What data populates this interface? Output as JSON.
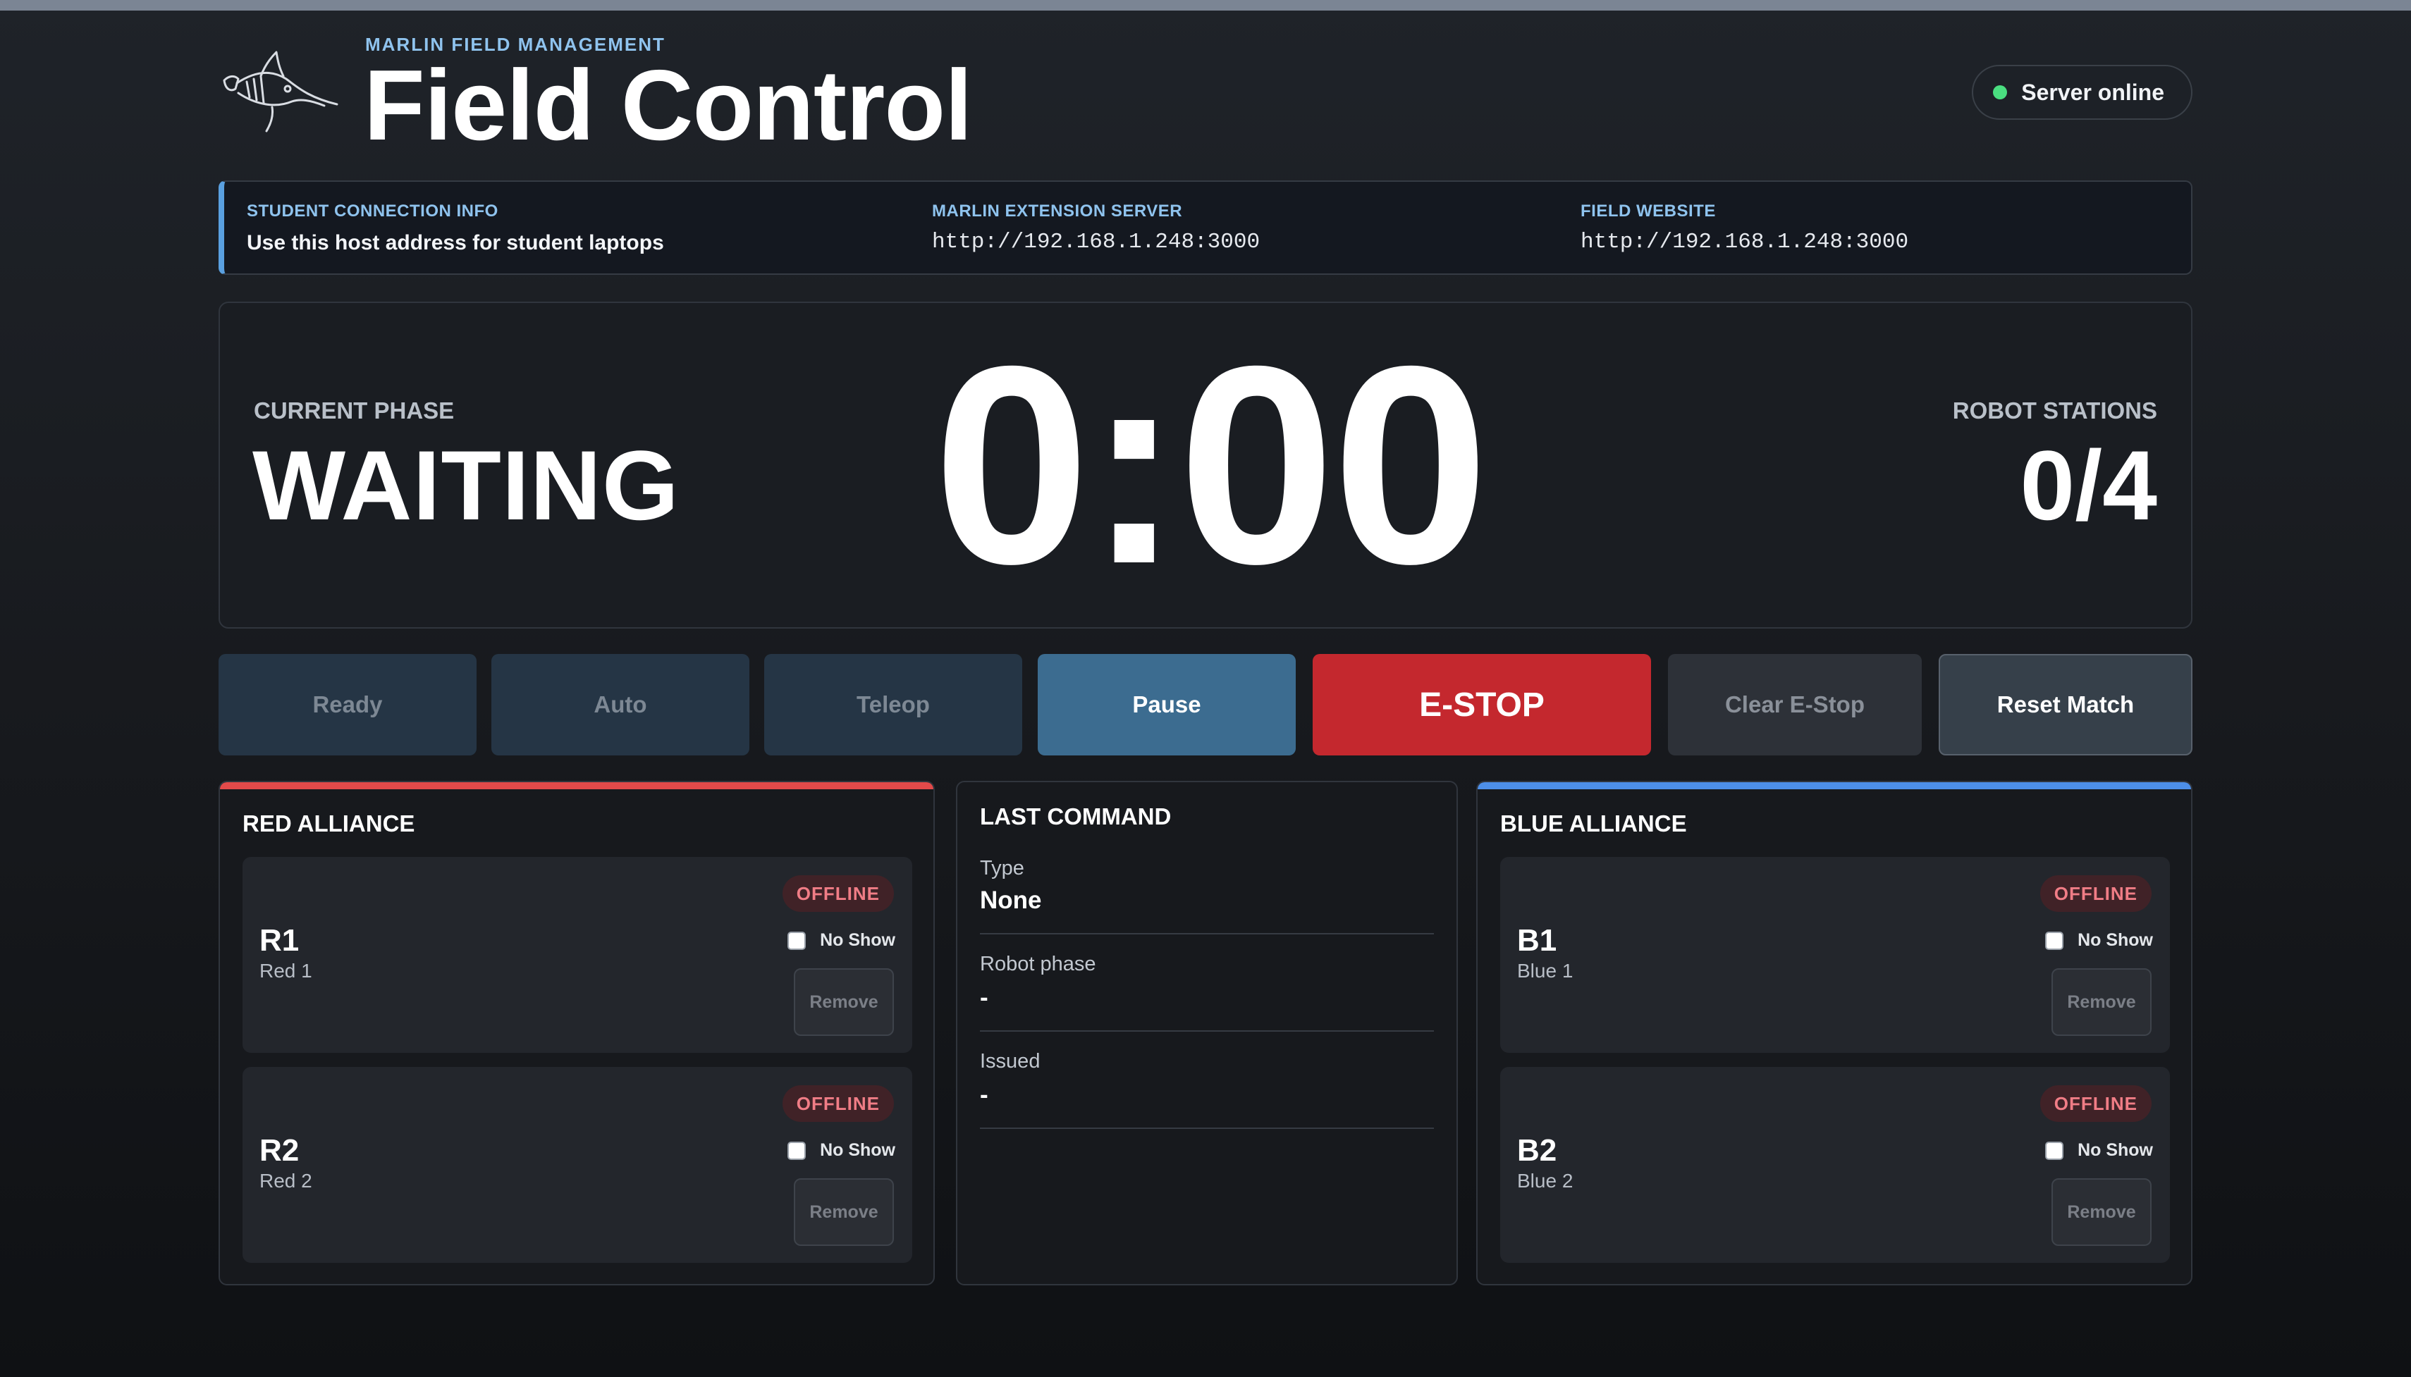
{
  "header": {
    "eyebrow": "MARLIN FIELD MANAGEMENT",
    "title": "Field Control",
    "logo_icon": "marlin-fish-logo",
    "server_status": "Server online",
    "server_status_color": "#4ade80"
  },
  "connection": {
    "student_label": "STUDENT CONNECTION INFO",
    "student_text": "Use this host address for student laptops",
    "extension_label": "MARLIN EXTENSION SERVER",
    "extension_url": "http://192.168.1.248:3000",
    "website_label": "FIELD WEBSITE",
    "website_url": "http://192.168.1.248:3000"
  },
  "match": {
    "phase_label": "CURRENT PHASE",
    "phase_value": "WAITING",
    "timer": "0:00",
    "stations_label": "ROBOT STATIONS",
    "stations_value": "0/4"
  },
  "controls": {
    "ready": "Ready",
    "auto": "Auto",
    "teleop": "Teleop",
    "pause": "Pause",
    "estop": "E-STOP",
    "clear_estop": "Clear E-Stop",
    "reset_match": "Reset Match"
  },
  "red_alliance": {
    "title": "RED ALLIANCE",
    "color": "#e24a4a",
    "robots": [
      {
        "id": "R1",
        "name": "Red 1",
        "status": "OFFLINE",
        "noshow_label": "No Show",
        "remove_label": "Remove"
      },
      {
        "id": "R2",
        "name": "Red 2",
        "status": "OFFLINE",
        "noshow_label": "No Show",
        "remove_label": "Remove"
      }
    ]
  },
  "last_command": {
    "title": "LAST COMMAND",
    "type_label": "Type",
    "type_value": "None",
    "robot_phase_label": "Robot phase",
    "robot_phase_value": "-",
    "issued_label": "Issued",
    "issued_value": "-"
  },
  "blue_alliance": {
    "title": "BLUE ALLIANCE",
    "color": "#4d8fe8",
    "robots": [
      {
        "id": "B1",
        "name": "Blue 1",
        "status": "OFFLINE",
        "noshow_label": "No Show",
        "remove_label": "Remove"
      },
      {
        "id": "B2",
        "name": "Blue 2",
        "status": "OFFLINE",
        "noshow_label": "No Show",
        "remove_label": "Remove"
      }
    ]
  }
}
